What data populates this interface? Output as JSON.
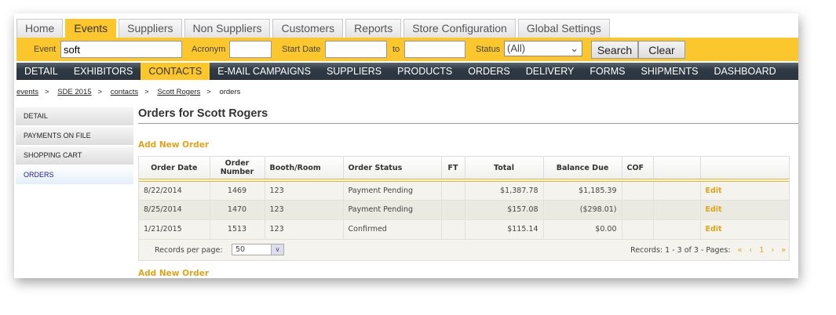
{
  "tabs": [
    "Home",
    "Events",
    "Suppliers",
    "Non Suppliers",
    "Customers",
    "Reports",
    "Store Configuration",
    "Global Settings"
  ],
  "search": {
    "event_label": "Event",
    "event_value": "soft",
    "acronym_label": "Acronym",
    "start_label": "Start Date",
    "to_label": "to",
    "status_label": "Status",
    "status_value": "(All)",
    "search_btn": "Search",
    "clear_btn": "Clear"
  },
  "nav": [
    "DETAIL",
    "EXHIBITORS",
    "CONTACTS",
    "E-MAIL CAMPAIGNS",
    "SUPPLIERS",
    "PRODUCTS",
    "ORDERS",
    "DELIVERY",
    "FORMS",
    "SHIPMENTS",
    "DASHBOARD"
  ],
  "breadcrumb": {
    "items": [
      "events",
      "SDE 2015",
      "contacts",
      "Scott Rogers"
    ],
    "current": "orders",
    "sep": ">"
  },
  "sidebar": [
    "DETAIL",
    "PAYMENTS ON FILE",
    "SHOPPING CART",
    "ORDERS"
  ],
  "title": "Orders for Scott Rogers",
  "add_new": "Add New Order",
  "table": {
    "headers": [
      "Order Date",
      "Order Number",
      "Booth/Room",
      "Order Status",
      "FT",
      "Total",
      "Balance Due",
      "COF",
      "",
      ""
    ],
    "rows": [
      [
        "8/22/2014",
        "1469",
        "123",
        "Payment Pending",
        "",
        "$1,387.78",
        "$1,185.39",
        "",
        "",
        "Edit"
      ],
      [
        "8/25/2014",
        "1470",
        "123",
        "Payment Pending",
        "",
        "$157.08",
        "($298.01)",
        "",
        "",
        "Edit"
      ],
      [
        "1/21/2015",
        "1513",
        "123",
        "Confirmed",
        "",
        "$115.14",
        "$0.00",
        "",
        "",
        "Edit"
      ]
    ]
  },
  "footer": {
    "rpp_label": "Records per page:",
    "rpp_value": "50",
    "records": "Records: 1 - 3 of 3 - Pages:",
    "first": "«",
    "prev": "‹",
    "page": "1",
    "next": "›",
    "last": "»"
  }
}
